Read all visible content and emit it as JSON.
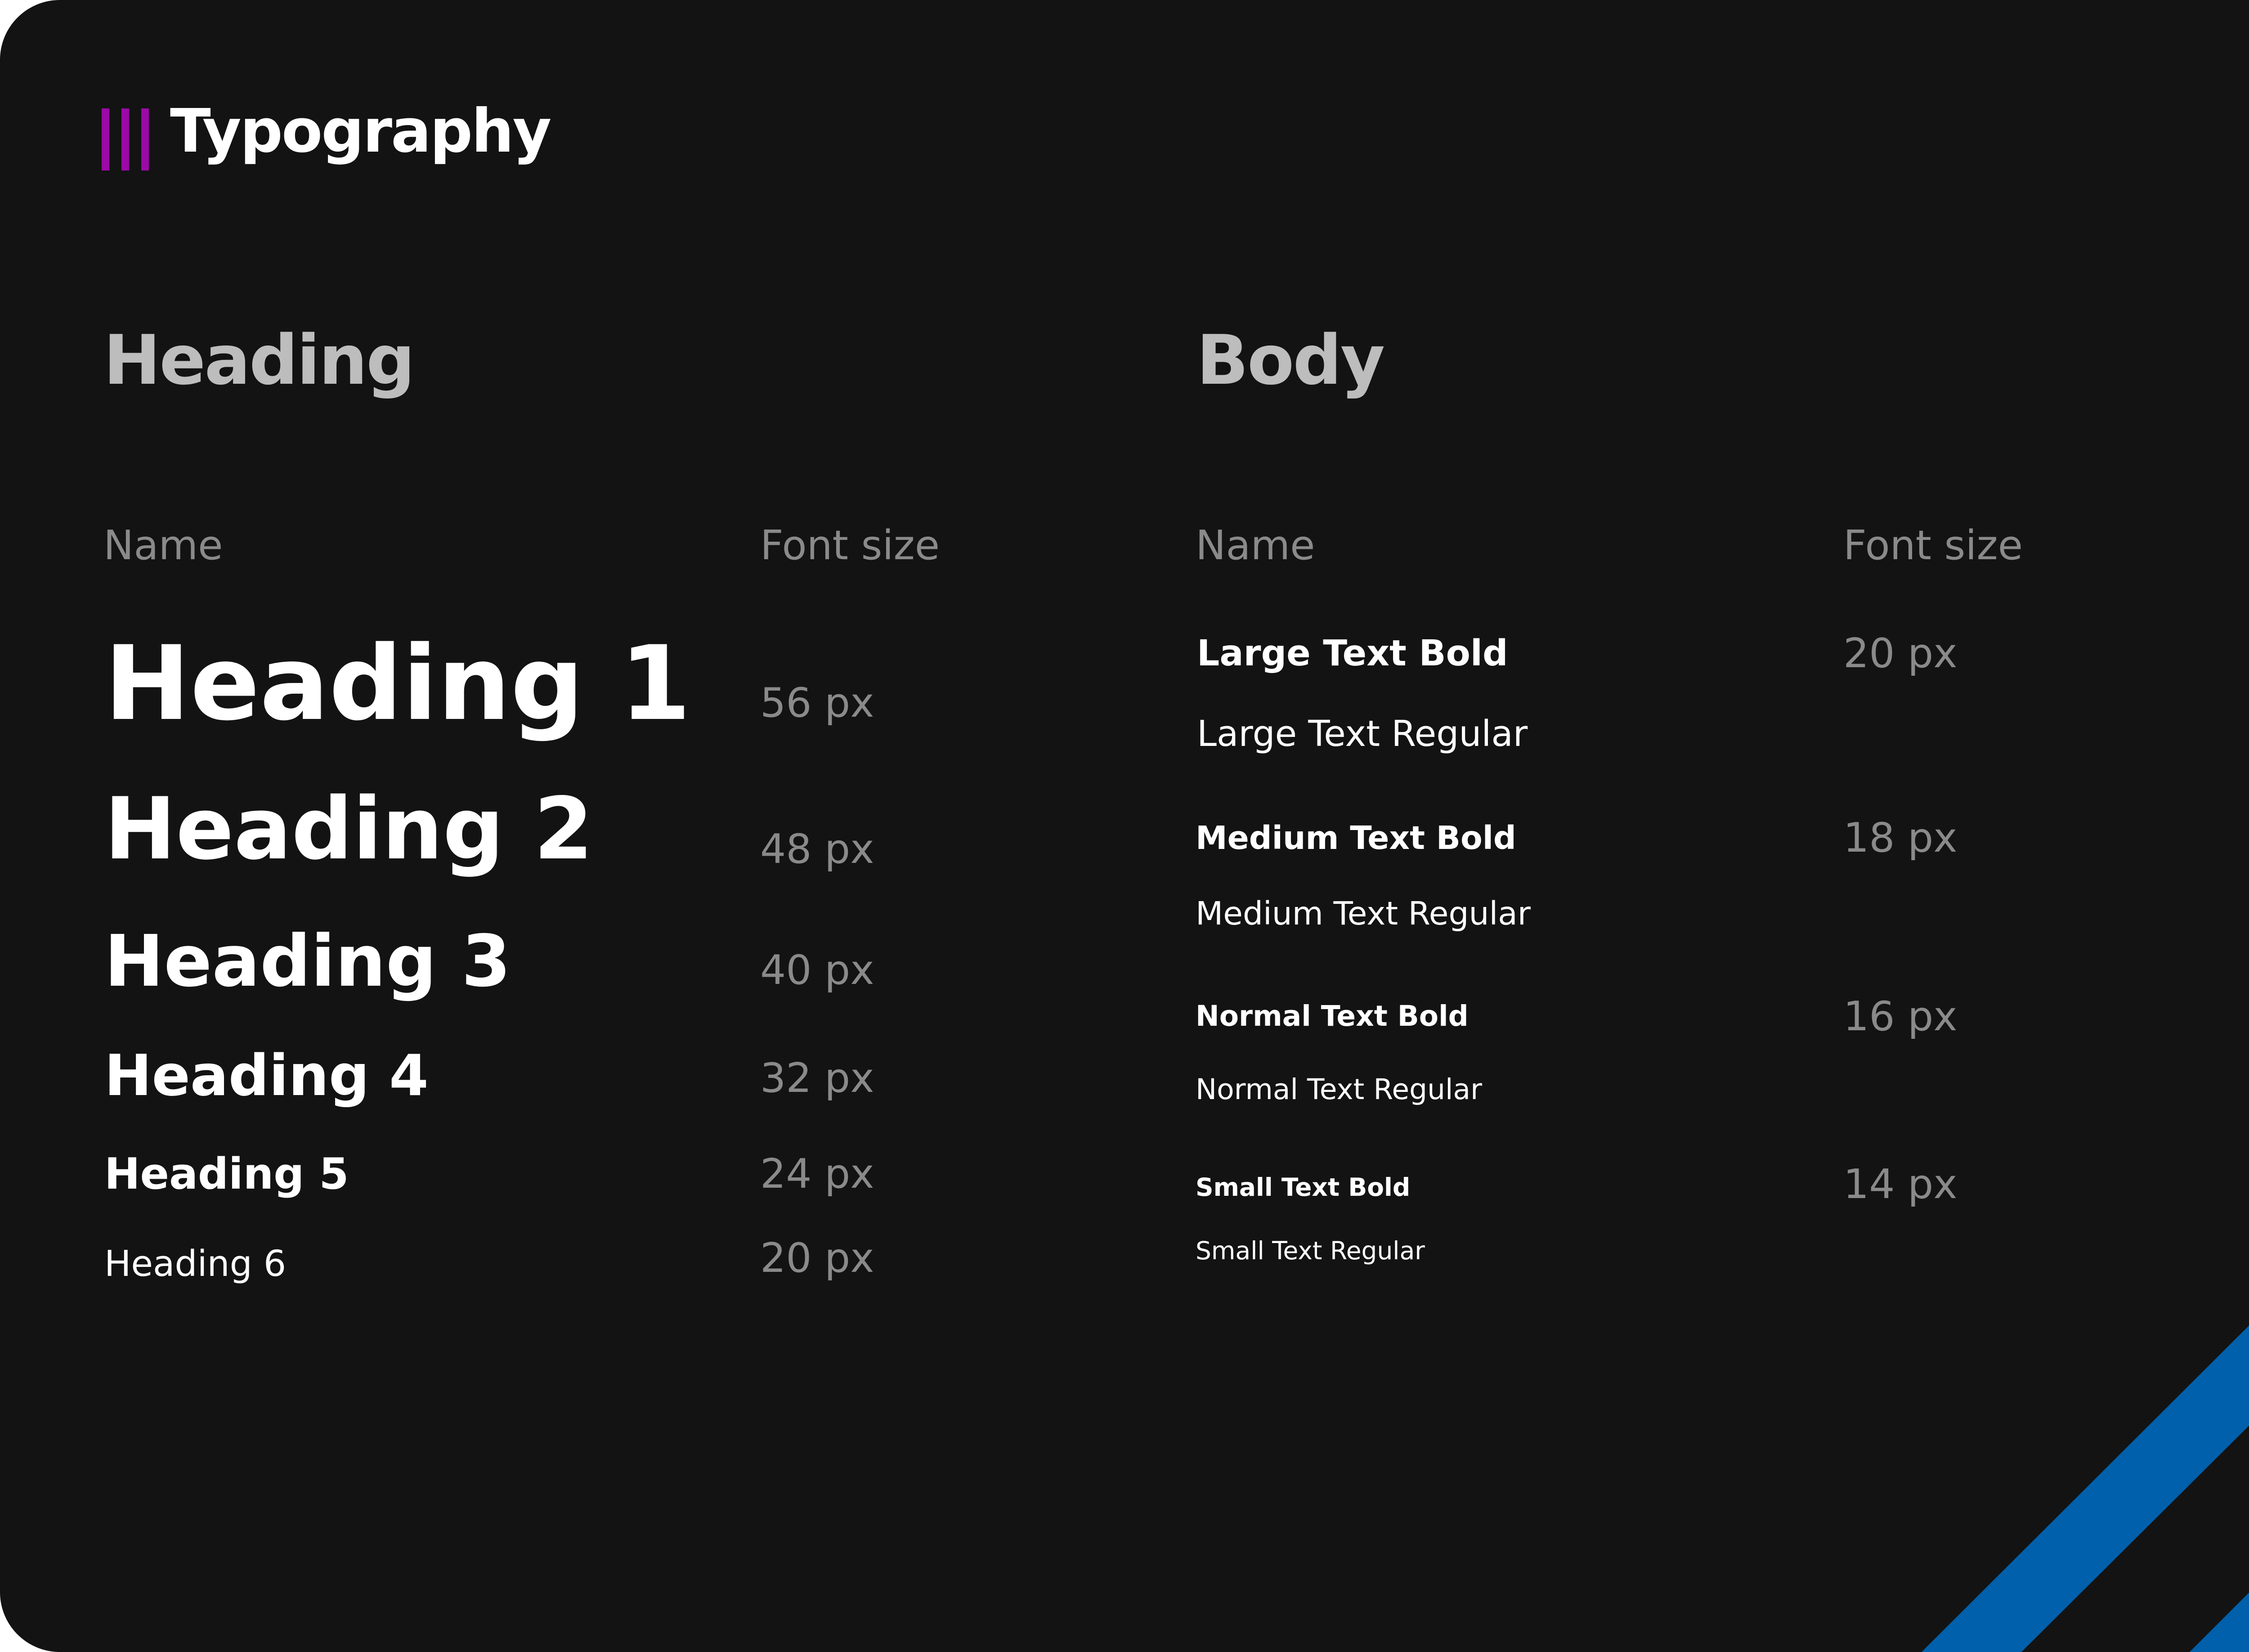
{
  "brand": {
    "title": "Typography",
    "accent_color": "#9b0aa6"
  },
  "heading_section": {
    "title": "Heading",
    "columns": {
      "name": "Name",
      "font_size": "Font size"
    },
    "rows": [
      {
        "name": "Heading 1",
        "size": "56 px"
      },
      {
        "name": "Heading 2",
        "size": "48 px"
      },
      {
        "name": "Heading 3",
        "size": "40 px"
      },
      {
        "name": "Heading 4",
        "size": "32 px"
      },
      {
        "name": "Heading 5",
        "size": "24 px"
      },
      {
        "name": "Heading 6",
        "size": "20 px"
      }
    ]
  },
  "body_section": {
    "title": "Body",
    "columns": {
      "name": "Name",
      "font_size": "Font size"
    },
    "groups": [
      {
        "bold": "Large Text Bold",
        "regular": "Large Text Regular",
        "size": "20 px"
      },
      {
        "bold": "Medium Text Bold",
        "regular": "Medium Text Regular",
        "size": "18 px"
      },
      {
        "bold": "Normal Text Bold",
        "regular": "Normal Text Regular",
        "size": "16 px"
      },
      {
        "bold": "Small Text Bold",
        "regular": "Small Text Regular",
        "size": "14 px"
      }
    ]
  },
  "colors": {
    "background": "#131313",
    "section_title": "#bdbdbd",
    "muted_text": "#8a8a8a",
    "sample_text": "#ffffff",
    "stripe_blue": "#0060ac"
  }
}
